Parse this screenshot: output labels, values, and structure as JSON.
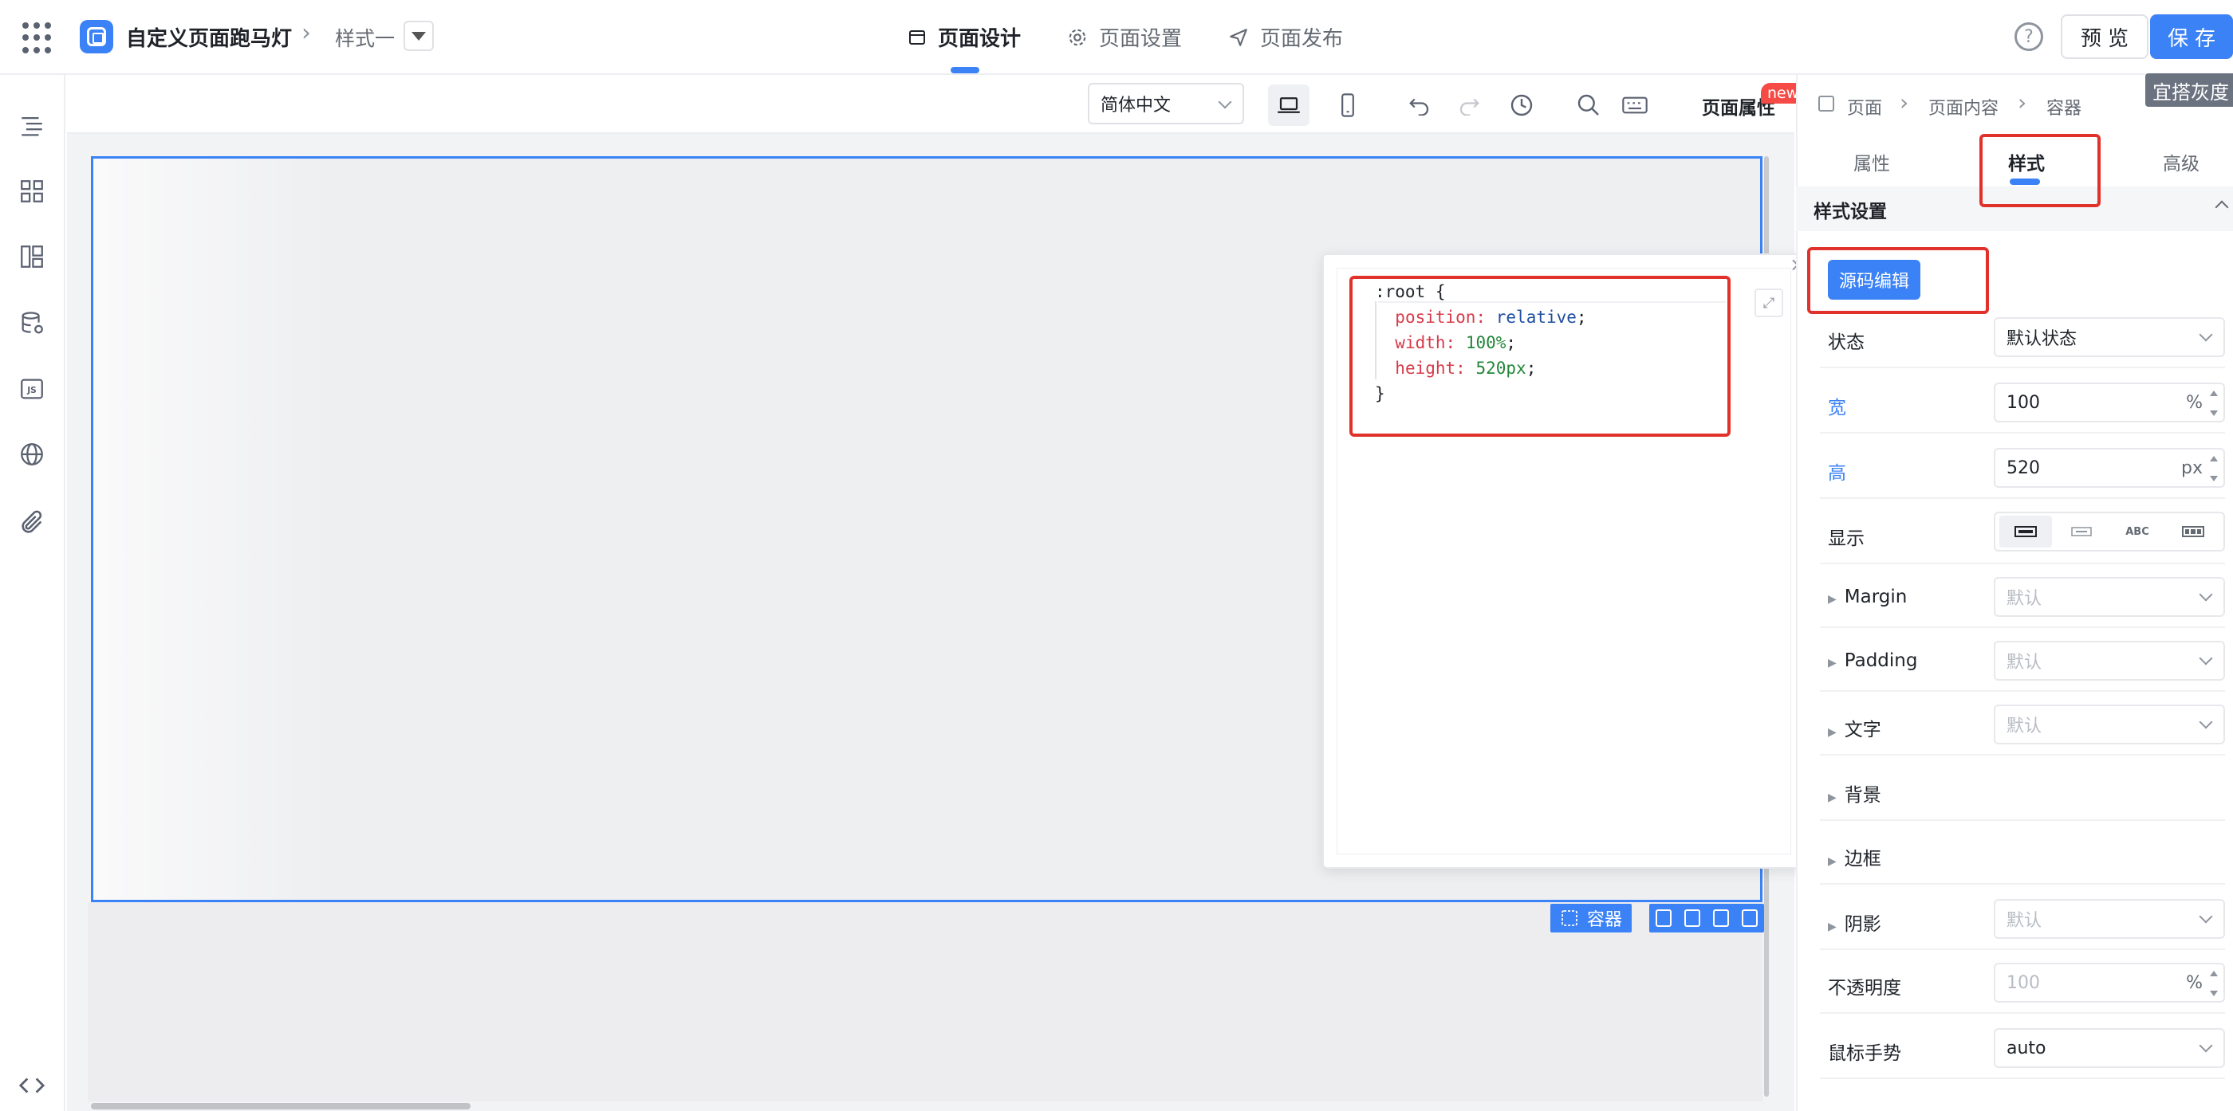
{
  "header": {
    "app_title": "自定义页面跑马灯",
    "style_name": "样式一",
    "nav_tabs": [
      {
        "label": "页面设计",
        "icon": "page-design-icon"
      },
      {
        "label": "页面设置",
        "icon": "gear-icon"
      },
      {
        "label": "页面发布",
        "icon": "send-icon"
      }
    ],
    "preview_label": "预览",
    "save_label": "保存",
    "gray_badge": "宜搭灰度"
  },
  "left_sidebar": {
    "items": [
      "outline-icon",
      "components-icon",
      "layout-icon",
      "datasource-icon",
      "js-icon",
      "globe-icon",
      "attachment-icon",
      "code-icon"
    ]
  },
  "toolbar": {
    "language": "简体中文",
    "page_props_label": "页面属性",
    "new_badge": "new"
  },
  "canvas": {
    "selected_component_label": "容器"
  },
  "code_editor": {
    "lines": [
      ":root {",
      "position",
      "relative",
      "width",
      "100%",
      "height",
      "520px",
      "}"
    ]
  },
  "right_panel": {
    "breadcrumb": [
      "页面",
      "页面内容",
      "容器"
    ],
    "tabs": [
      "属性",
      "样式",
      "高级"
    ],
    "active_tab": "样式",
    "section_title": "样式设置",
    "source_edit_button": "源码编辑",
    "props": {
      "state_label": "状态",
      "state_value": "默认状态",
      "width_label": "宽",
      "width_value": "100",
      "width_unit": "%",
      "height_label": "高",
      "height_value": "520",
      "height_unit": "px",
      "display_label": "显示",
      "display_option_abc": "ABC",
      "margin_label": "Margin",
      "margin_value": "默认",
      "padding_label": "Padding",
      "padding_value": "默认",
      "text_label": "文字",
      "text_value": "默认",
      "background_label": "背景",
      "border_label": "边框",
      "shadow_label": "阴影",
      "shadow_value": "默认",
      "opacity_label": "不透明度",
      "opacity_placeholder": "100",
      "opacity_unit": "%",
      "cursor_label": "鼠标手势",
      "cursor_value": "auto"
    }
  },
  "colors": {
    "accent": "#3b82f6",
    "highlight": "#e0322b",
    "new_badge": "#f54a45"
  }
}
